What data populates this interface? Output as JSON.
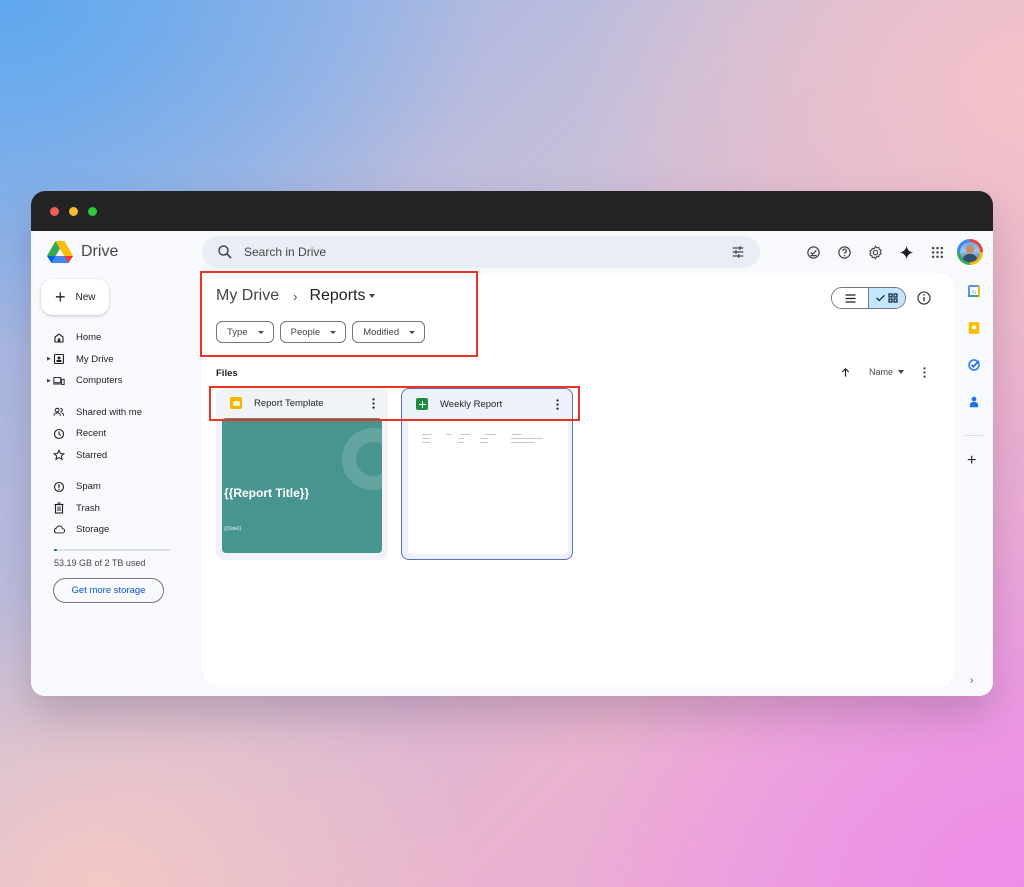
{
  "app": {
    "name": "Drive",
    "new_button": "New"
  },
  "search": {
    "placeholder": "Search in Drive",
    "value": ""
  },
  "top_icons": [
    "offline-status-icon",
    "help-icon",
    "settings-icon",
    "gemini-icon",
    "apps-grid-icon",
    "account-avatar"
  ],
  "sidebar": {
    "items": [
      {
        "label": "Home",
        "icon": "home-icon"
      },
      {
        "label": "My Drive",
        "icon": "my-drive-icon",
        "expandable": true
      },
      {
        "label": "Computers",
        "icon": "computers-icon",
        "expandable": true
      },
      {
        "label": "Shared with me",
        "icon": "shared-icon"
      },
      {
        "label": "Recent",
        "icon": "clock-icon"
      },
      {
        "label": "Starred",
        "icon": "star-icon"
      },
      {
        "label": "Spam",
        "icon": "spam-icon"
      },
      {
        "label": "Trash",
        "icon": "trash-icon"
      },
      {
        "label": "Storage",
        "icon": "cloud-icon"
      }
    ],
    "storage": {
      "used_text": "53.19 GB of 2 TB used",
      "used_fraction": 0.026,
      "button": "Get more storage"
    }
  },
  "main": {
    "breadcrumb": {
      "root": "My Drive",
      "separator": "›",
      "current": "Reports"
    },
    "filters": [
      "Type",
      "People",
      "Modified"
    ],
    "view": {
      "mode": "grid"
    },
    "section_label": "Files",
    "sort": {
      "field": "Name",
      "direction": "ascending"
    },
    "files": [
      {
        "name": "Report Template",
        "type": "slides",
        "thumbnail": {
          "title": "{{Report Title}}",
          "subtitle": "{{Date}}"
        }
      },
      {
        "name": "Weekly Report",
        "type": "sheets",
        "selected": true
      }
    ]
  },
  "side_rail": [
    "calendar-icon",
    "keep-icon",
    "tasks-icon",
    "contacts-icon",
    "add-addon-icon"
  ],
  "colors": {
    "accent": "#0b57d0",
    "selected_toggle": "#c2e7ff",
    "highlight": "#ea3323",
    "slide_thumb": "#489590"
  }
}
